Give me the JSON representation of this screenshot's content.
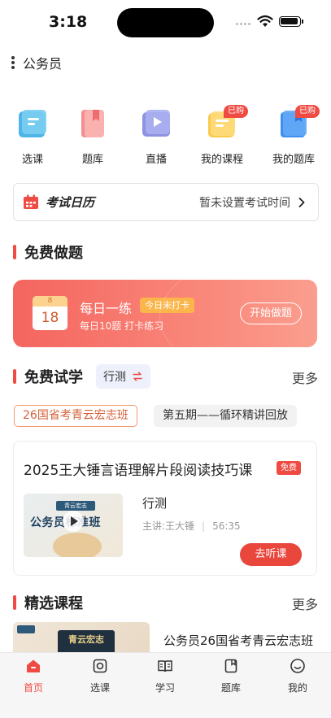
{
  "status_bar": {
    "time": "3:18"
  },
  "header": {
    "title": "公务员"
  },
  "quick_nav": [
    {
      "label": "选课",
      "icon": "course-select-icon",
      "badge": ""
    },
    {
      "label": "题库",
      "icon": "question-bank-icon",
      "badge": ""
    },
    {
      "label": "直播",
      "icon": "live-play-icon",
      "badge": ""
    },
    {
      "label": "我的课程",
      "icon": "my-courses-icon",
      "badge": "已购"
    },
    {
      "label": "我的题库",
      "icon": "my-question-bank-icon",
      "badge": "已购"
    }
  ],
  "exam_calendar": {
    "title": "考试日历",
    "status": "暂未设置考试时间"
  },
  "free_practice": {
    "section_title": "免费做题",
    "calendar_month": "8",
    "calendar_day": "18",
    "title": "每日一练",
    "tag": "今日未打卡",
    "subtitle": "每日10题 打卡练习",
    "button": "开始做题"
  },
  "free_trial": {
    "section_title": "免费试学",
    "subject": "行测",
    "more": "更多",
    "tabs": [
      "26国省考青云宏志班",
      "第五期——循环精讲回放"
    ],
    "course": {
      "title": "2025王大锤言语理解片段阅读技巧课",
      "badge": "免费",
      "thumb_badge": "青云宏志",
      "thumb_title": "公务员标准班",
      "subject": "行测",
      "teacher": "主讲:王大锤",
      "duration": "56:35",
      "button": "去听课"
    }
  },
  "selected_courses": {
    "section_title": "精选课程",
    "more": "更多",
    "thumb_text": "青云宏志",
    "first_title": "公务员26国省考青云宏志班"
  },
  "tab_bar": [
    {
      "label": "首页",
      "active": true
    },
    {
      "label": "选课",
      "active": false
    },
    {
      "label": "学习",
      "active": false
    },
    {
      "label": "题库",
      "active": false
    },
    {
      "label": "我的",
      "active": false
    }
  ],
  "colors": {
    "accent": "#ef4b43",
    "banner": "#f4655f",
    "badge_orange": "#fbb54a"
  }
}
